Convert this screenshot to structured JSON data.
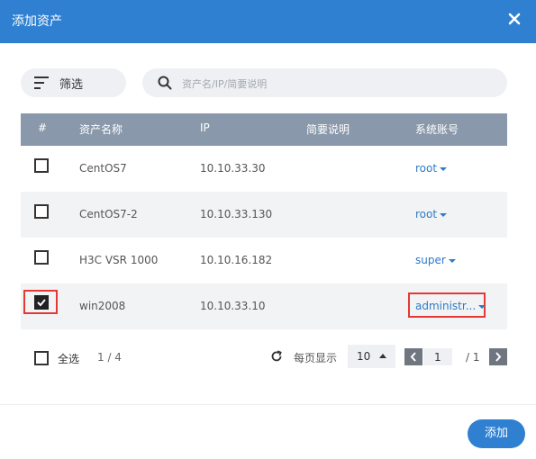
{
  "dialog": {
    "title": "添加资产",
    "close_icon": "close-icon"
  },
  "toolbar": {
    "filter_label": "筛选",
    "filter_icon": "filter-icon",
    "search_placeholder": "资产名/IP/简要说明",
    "search_value": ""
  },
  "table": {
    "headers": [
      "#",
      "资产名称",
      "IP",
      "简要说明",
      "系统账号"
    ],
    "rows": [
      {
        "checked": false,
        "name": "CentOS7",
        "ip": "10.10.33.30",
        "desc": "",
        "account": "root"
      },
      {
        "checked": false,
        "name": "CentOS7-2",
        "ip": "10.10.33.130",
        "desc": "",
        "account": "root"
      },
      {
        "checked": false,
        "name": "H3C VSR 1000",
        "ip": "10.10.16.182",
        "desc": "",
        "account": "super"
      },
      {
        "checked": true,
        "name": "win2008",
        "ip": "10.10.33.10",
        "desc": "",
        "account": "administr..."
      }
    ]
  },
  "footer": {
    "select_all_label": "全选",
    "count": "1 / 4",
    "per_page_label": "每页显示",
    "per_page_value": "10",
    "page_input": "1",
    "page_total": "/ 1"
  },
  "actions": {
    "add_label": "添加"
  },
  "colors": {
    "primary": "#2f80d1",
    "header_gray": "#8a98ab",
    "highlight": "#e53935"
  }
}
